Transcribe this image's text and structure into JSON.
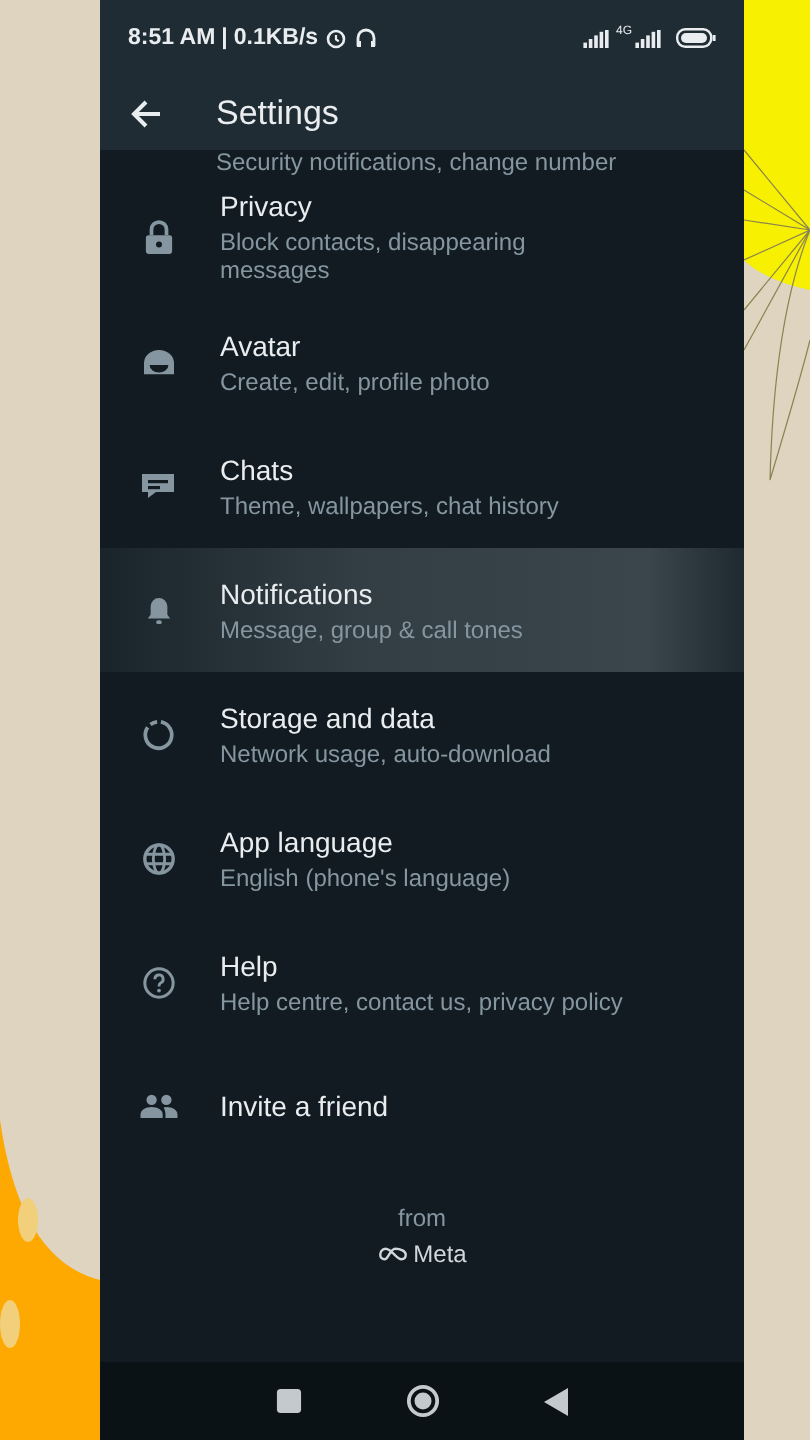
{
  "status_bar": {
    "time": "8:51 AM",
    "separator": "|",
    "speed": "0.1KB/s",
    "network": "4G"
  },
  "app_bar": {
    "title": "Settings"
  },
  "settings": {
    "partial_subtitle": "Security notifications, change number",
    "items": [
      {
        "title": "Privacy",
        "subtitle": "Block contacts, disappearing messages",
        "selected": false
      },
      {
        "title": "Avatar",
        "subtitle": "Create, edit, profile photo",
        "selected": false
      },
      {
        "title": "Chats",
        "subtitle": "Theme, wallpapers, chat history",
        "selected": false
      },
      {
        "title": "Notifications",
        "subtitle": "Message, group & call tones",
        "selected": true
      },
      {
        "title": "Storage and data",
        "subtitle": "Network usage, auto-download",
        "selected": false
      },
      {
        "title": "App language",
        "subtitle": "English (phone's language)",
        "selected": false
      },
      {
        "title": "Help",
        "subtitle": "Help centre, contact us, privacy policy",
        "selected": false
      },
      {
        "title": "Invite a friend",
        "selected": false
      }
    ]
  },
  "footer": {
    "from": "from",
    "brand": "Meta"
  }
}
